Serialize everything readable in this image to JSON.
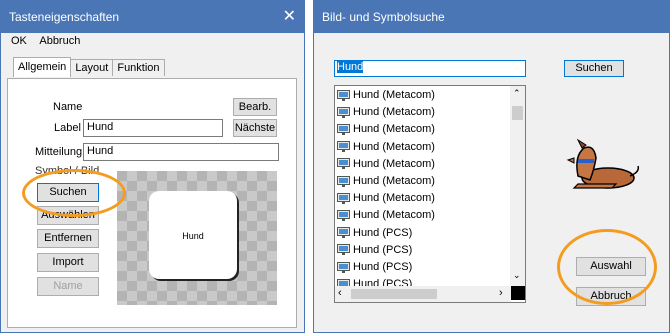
{
  "left_window": {
    "title": "Tasteneigenschaften",
    "close_glyph": "✕",
    "menu": [
      "OK",
      "Abbruch"
    ],
    "tabs": [
      "Allgemein",
      "Layout",
      "Funktion"
    ],
    "fields": {
      "name_label": "Name",
      "label_label": "Label",
      "label_value": "Hund",
      "message_label": "Mitteilung",
      "message_value": "Hund"
    },
    "buttons": {
      "edit": "Bearb.",
      "next": "Nächste",
      "search": "Suchen",
      "select": "Auswählen",
      "remove": "Entfernen",
      "import": "Import",
      "name": "Name"
    },
    "group_label": "Symbol / Bild",
    "preview_text": "Hund"
  },
  "right_window": {
    "title": "Bild- und Symbolsuche",
    "search_value": "Hund",
    "search_button": "Suchen",
    "results": [
      "Hund (Metacom)",
      "Hund (Metacom)",
      "Hund (Metacom)",
      "Hund (Metacom)",
      "Hund (Metacom)",
      "Hund (Metacom)",
      "Hund (Metacom)",
      "Hund (Metacom)",
      "Hund (PCS)",
      "Hund (PCS)",
      "Hund (PCS)",
      "Hund (PCS)"
    ],
    "select_button": "Auswahl",
    "cancel_button": "Abbruch",
    "preview_icon": "dog-icon"
  },
  "colors": {
    "titlebar": "#4a76b6",
    "highlight_circle": "#f39c1f",
    "selection": "#0078d7"
  }
}
